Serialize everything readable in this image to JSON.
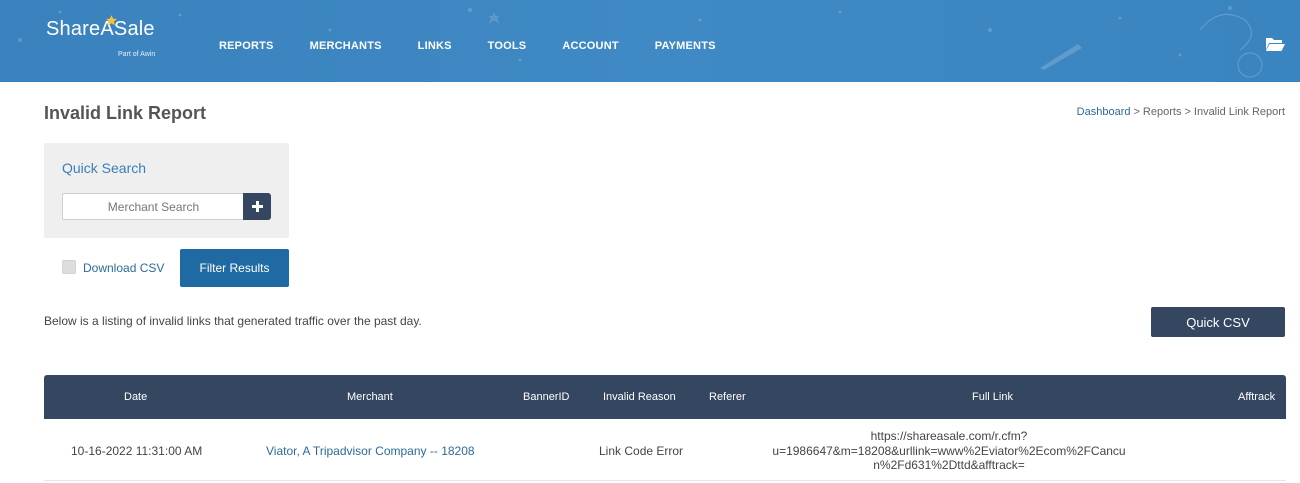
{
  "header": {
    "logo": {
      "name": "ShareASale",
      "sub": "Part of Awin"
    },
    "nav": [
      "REPORTS",
      "MERCHANTS",
      "LINKS",
      "TOOLS",
      "ACCOUNT",
      "PAYMENTS"
    ],
    "bg_color": "#3f89c4"
  },
  "page": {
    "title": "Invalid Link Report",
    "breadcrumb": [
      "Dashboard",
      "Reports",
      "Invalid Link Report"
    ],
    "breadcrumb_sep": ">"
  },
  "quick_search": {
    "title": "Quick Search",
    "placeholder": "Merchant Search"
  },
  "controls": {
    "download_csv_label": "Download CSV",
    "download_csv_checked": false,
    "filter_button": "Filter Results",
    "description": "Below is a listing of invalid links that generated traffic over the past day.",
    "quick_csv_button": "Quick CSV"
  },
  "table": {
    "headers": [
      "Date",
      "Merchant",
      "BannerID",
      "Invalid Reason",
      "Referer",
      "Full Link",
      "Afftrack"
    ],
    "rows": [
      {
        "date": "10-16-2022 11:31:00 AM",
        "merchant": "Viator, A Tripadvisor Company -- 18208",
        "banner_id": "",
        "invalid_reason": "Link Code Error",
        "referer": "",
        "full_link_lines": [
          "https://shareasale.com/r.cfm?",
          "u=1986647&m=18208&urllink=www%2Eviator%2Ecom%2FCancu",
          "n%2Fd631%2Dttd&afftrack="
        ],
        "afftrack": ""
      }
    ]
  },
  "colors": {
    "accent_blue": "#1f6aa3",
    "dark_navy": "#344660",
    "link_blue": "#2d6a9b"
  }
}
